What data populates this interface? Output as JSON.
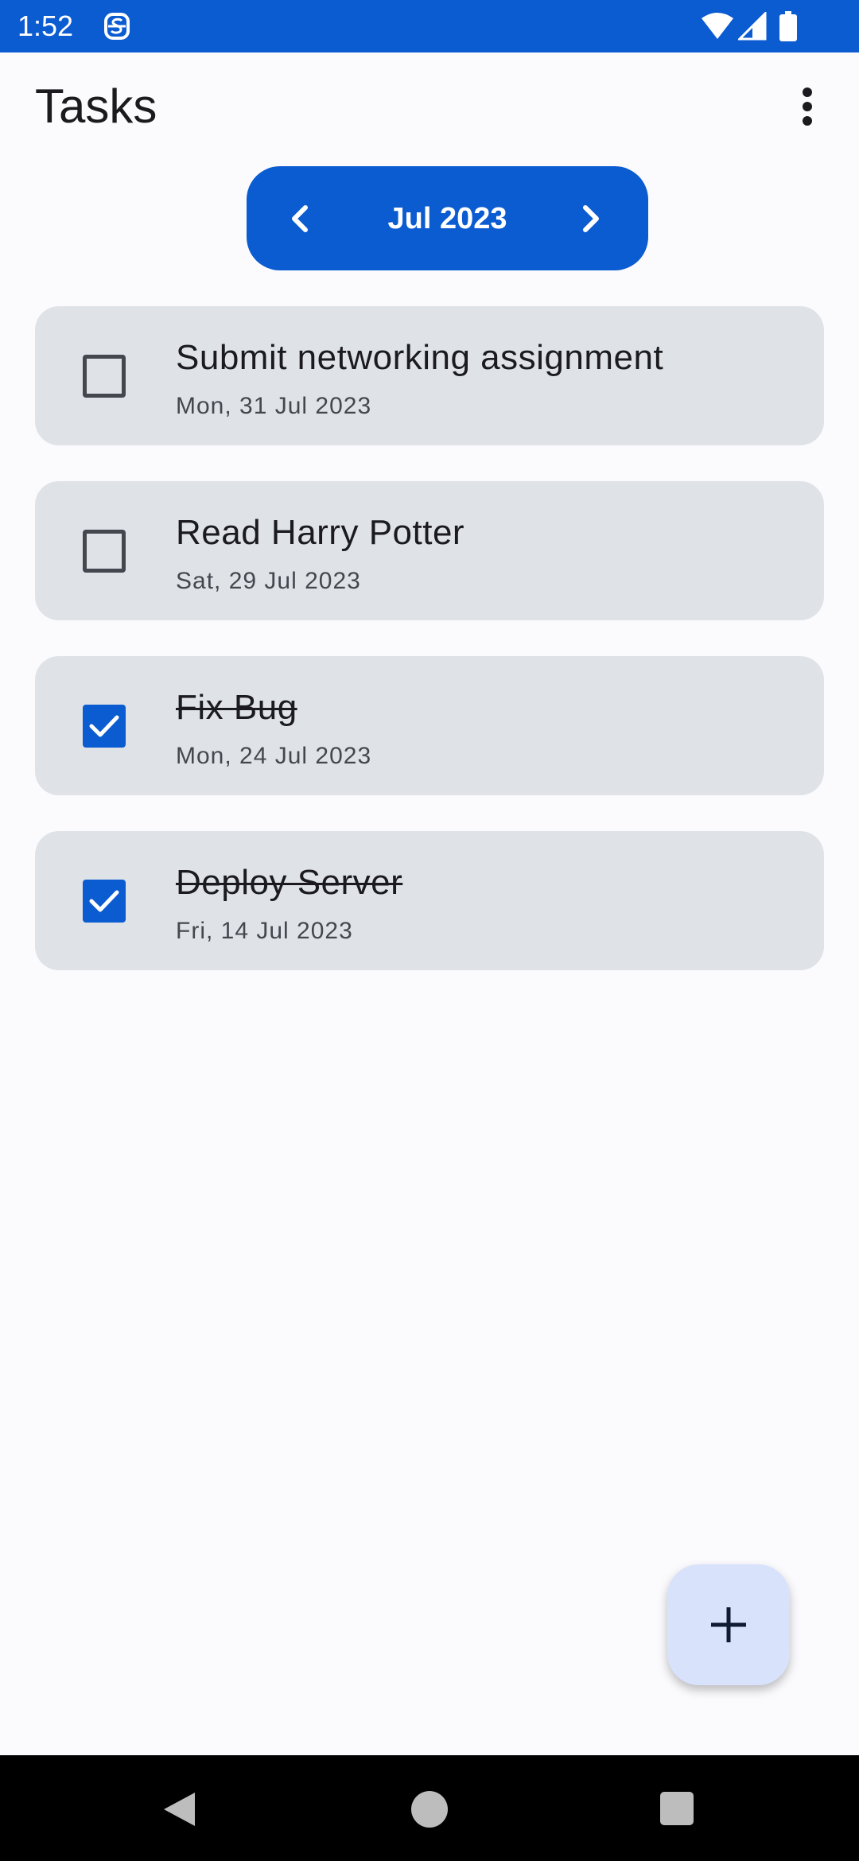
{
  "status_bar": {
    "time": "1:52",
    "app_icon": "s-stroke-icon",
    "icons": [
      "wifi-icon",
      "signal-icon",
      "battery-icon"
    ],
    "background": "#0b5bd1"
  },
  "header": {
    "title": "Tasks",
    "menu_icon": "more-vert-icon"
  },
  "month_selector": {
    "label": "Jul 2023",
    "prev_icon": "chevron-left-icon",
    "next_icon": "chevron-right-icon",
    "color": "#0b5bd1"
  },
  "tasks": [
    {
      "title": "Submit networking assignment",
      "date": "Mon, 31 Jul 2023",
      "completed": false
    },
    {
      "title": "Read Harry Potter",
      "date": "Sat, 29 Jul 2023",
      "completed": false
    },
    {
      "title": "Fix Bug",
      "date": "Mon, 24 Jul 2023",
      "completed": true
    },
    {
      "title": "Deploy Server",
      "date": "Fri, 14 Jul 2023",
      "completed": true
    }
  ],
  "fab": {
    "icon": "plus-icon",
    "color": "#d8e2fb"
  },
  "nav_bar": {
    "icons": [
      "back-icon",
      "home-icon",
      "recents-icon"
    ]
  }
}
